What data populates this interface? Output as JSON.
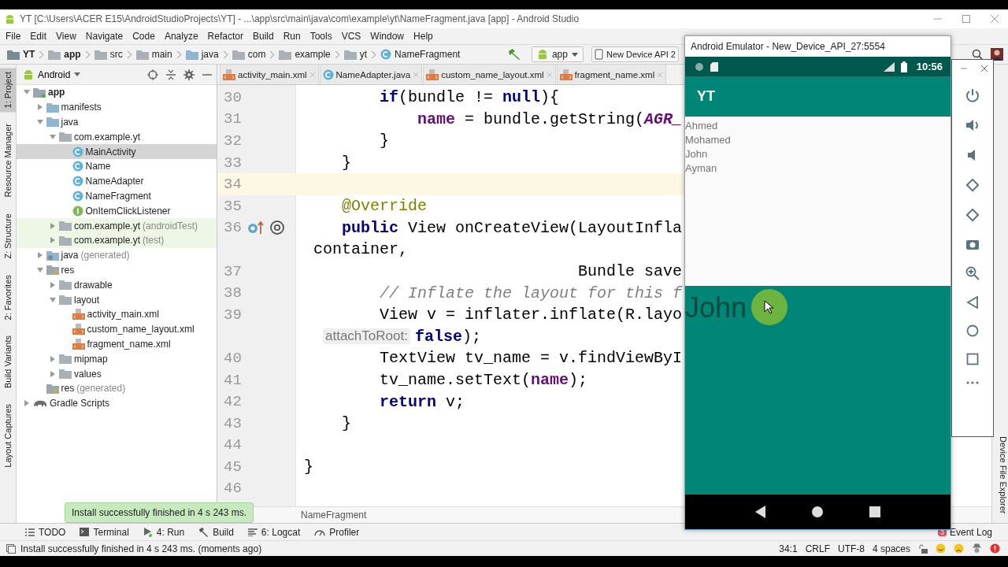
{
  "window": {
    "title": "YT [C:\\Users\\ACER E15\\AndroidStudioProjects\\YT] - ...\\app\\src\\main\\java\\com\\example\\yt\\NameFragment.java [app] - Android Studio"
  },
  "menu": [
    "File",
    "Edit",
    "View",
    "Navigate",
    "Code",
    "Analyze",
    "Refactor",
    "Build",
    "Run",
    "Tools",
    "VCS",
    "Window",
    "Help"
  ],
  "navigation_bar": {
    "breadcrumbs": [
      {
        "label": "YT",
        "kind": "project"
      },
      {
        "label": "app",
        "kind": "module"
      },
      {
        "label": "src",
        "kind": "folder"
      },
      {
        "label": "main",
        "kind": "folder"
      },
      {
        "label": "java",
        "kind": "source"
      },
      {
        "label": "com",
        "kind": "folder"
      },
      {
        "label": "example",
        "kind": "folder"
      },
      {
        "label": "yt",
        "kind": "folder"
      },
      {
        "label": "NameFragment",
        "kind": "class"
      }
    ],
    "run_config": "app",
    "device": "New Device API 2"
  },
  "left_tool_strip": [
    {
      "label": "1: Project",
      "selected": true
    },
    {
      "label": "Resource Manager",
      "selected": false
    },
    {
      "label": "Z: Structure",
      "selected": false
    },
    {
      "label": "2: Favorites",
      "selected": false
    },
    {
      "label": "Build Variants",
      "selected": false
    },
    {
      "label": "Layout Captures",
      "selected": false
    }
  ],
  "project_panel": {
    "view": "Android",
    "tree": [
      {
        "label": "app",
        "kind": "module",
        "expanded": true,
        "selected": false,
        "children": [
          {
            "label": "manifests",
            "kind": "folder",
            "expanded": false,
            "selected": false
          },
          {
            "label": "java",
            "kind": "folder",
            "expanded": true,
            "selected": false,
            "children": [
              {
                "label": "com.example.yt",
                "kind": "package",
                "expanded": true,
                "selected": false,
                "children": [
                  {
                    "label": "MainActivity",
                    "kind": "class",
                    "selected": true
                  },
                  {
                    "label": "Name",
                    "kind": "class",
                    "selected": false
                  },
                  {
                    "label": "NameAdapter",
                    "kind": "class",
                    "selected": false
                  },
                  {
                    "label": "NameFragment",
                    "kind": "class",
                    "selected": false
                  },
                  {
                    "label": "OnItemClickListener",
                    "kind": "interface",
                    "selected": false
                  }
                ]
              },
              {
                "label": "com.example.yt",
                "suffix": "(androidTest)",
                "kind": "test-package",
                "expanded": false,
                "selected": false
              },
              {
                "label": "com.example.yt",
                "suffix": "(test)",
                "kind": "test-package",
                "expanded": false,
                "selected": false
              }
            ]
          },
          {
            "label": "java",
            "suffix": "(generated)",
            "kind": "generated",
            "expanded": false,
            "selected": false
          },
          {
            "label": "res",
            "kind": "res",
            "expanded": true,
            "selected": false,
            "children": [
              {
                "label": "drawable",
                "kind": "package",
                "expanded": false,
                "selected": false
              },
              {
                "label": "layout",
                "kind": "package",
                "expanded": true,
                "selected": false,
                "children": [
                  {
                    "label": "activity_main.xml",
                    "kind": "xml",
                    "selected": false
                  },
                  {
                    "label": "custom_name_layout.xml",
                    "kind": "xml",
                    "selected": false
                  },
                  {
                    "label": "fragment_name.xml",
                    "kind": "xml",
                    "selected": false
                  }
                ]
              },
              {
                "label": "mipmap",
                "kind": "package",
                "expanded": false,
                "selected": false
              },
              {
                "label": "values",
                "kind": "package",
                "expanded": false,
                "selected": false
              }
            ]
          },
          {
            "label": "res",
            "suffix": "(generated)",
            "kind": "res"
          }
        ]
      },
      {
        "label": "Gradle Scripts",
        "kind": "gradle",
        "expanded": false,
        "selected": false
      }
    ]
  },
  "editor": {
    "tabs": [
      {
        "label": "activity_main.xml",
        "kind": "xml",
        "selected": false
      },
      {
        "label": "NameAdapter.java",
        "kind": "class",
        "selected": false
      },
      {
        "label": "custom_name_layout.xml",
        "kind": "xml",
        "selected": false
      },
      {
        "label": "fragment_name.xml",
        "kind": "xml",
        "selected": false
      }
    ],
    "lines": [
      {
        "number": "30",
        "current": false,
        "tokens": [
          {
            "kind": "keyword",
            "text": "        if"
          },
          {
            "kind": "plain",
            "text": "(bundle != "
          },
          {
            "kind": "keyword",
            "text": "null"
          },
          {
            "kind": "plain",
            "text": "){"
          }
        ]
      },
      {
        "number": "31",
        "current": false,
        "tokens": [
          {
            "kind": "field",
            "text": "            name"
          },
          {
            "kind": "plain",
            "text": " = bundle.getString("
          },
          {
            "kind": "constant",
            "text": "AGR_"
          }
        ]
      },
      {
        "number": "32",
        "current": false,
        "tokens": [
          {
            "kind": "plain",
            "text": "        }"
          }
        ]
      },
      {
        "number": "33",
        "current": false,
        "tokens": [
          {
            "kind": "plain",
            "text": "    }"
          }
        ]
      },
      {
        "number": "34",
        "current": true
      },
      {
        "number": "35",
        "current": false,
        "tokens": [
          {
            "kind": "annotation",
            "text": "    @Override"
          }
        ]
      },
      {
        "number": "36",
        "current": false,
        "override_marker": true,
        "tokens": [
          {
            "kind": "keyword",
            "text": "    public"
          },
          {
            "kind": "plain",
            "text": " View onCreateView(LayoutInfla"
          }
        ]
      },
      {
        "current": false,
        "tokens": [
          {
            "kind": "plain",
            "text": " container,"
          }
        ]
      },
      {
        "number": "37",
        "current": false,
        "tokens": [
          {
            "kind": "plain",
            "text": "                             Bundle save"
          }
        ]
      },
      {
        "number": "38",
        "current": false,
        "tokens": [
          {
            "kind": "comment",
            "text": "        // Inflate the layout for this f"
          }
        ]
      },
      {
        "number": "39",
        "current": false,
        "tokens": [
          {
            "kind": "plain",
            "text": "        View v = inflater.inflate(R.layo"
          }
        ]
      },
      {
        "current": false,
        "tokens": [
          {
            "kind": "hint",
            "text": "attachToRoot:"
          },
          {
            "kind": "keyword",
            "text": "false"
          },
          {
            "kind": "plain",
            "text": ");"
          }
        ]
      },
      {
        "number": "40",
        "current": false,
        "tokens": [
          {
            "kind": "plain",
            "text": "        TextView tv_name = v.findViewByI"
          }
        ]
      },
      {
        "number": "41",
        "current": false,
        "tokens": [
          {
            "kind": "plain",
            "text": "        tv_name.setText("
          },
          {
            "kind": "field",
            "text": "name"
          },
          {
            "kind": "plain",
            "text": ");"
          }
        ]
      },
      {
        "number": "42",
        "current": false,
        "tokens": [
          {
            "kind": "keyword",
            "text": "        return"
          },
          {
            "kind": "plain",
            "text": " v;"
          }
        ]
      },
      {
        "number": "43",
        "current": false,
        "tokens": [
          {
            "kind": "plain",
            "text": "    }"
          }
        ]
      },
      {
        "number": "44",
        "current": false
      },
      {
        "number": "45",
        "current": false,
        "tokens": [
          {
            "kind": "plain",
            "text": "}"
          }
        ]
      },
      {
        "number": "46",
        "current": false
      }
    ],
    "breadcrumb": "NameFragment"
  },
  "toast": "Install successfully finished in 4 s 243 ms.",
  "tool_windows": [
    {
      "label": "TODO",
      "kind": "list"
    },
    {
      "label": "Terminal",
      "kind": "terminal"
    },
    {
      "label": "4: Run",
      "kind": "run"
    },
    {
      "label": "Build",
      "kind": "build"
    },
    {
      "label": "6: Logcat",
      "kind": "logcat"
    },
    {
      "label": "Profiler",
      "kind": "profiler"
    }
  ],
  "event_log": {
    "label": "Event Log",
    "count": "3"
  },
  "status_bar": {
    "message": "Install successfully finished in 4 s 243 ms. (moments ago)",
    "position": "34:1",
    "line_separator": "CRLF",
    "encoding": "UTF-8",
    "indent": "4 spaces"
  },
  "right_tool_strip": [
    "Device File Explorer"
  ],
  "emulator": {
    "title": "Android Emulator - New_Device_API_27:5554",
    "clock": "10:56",
    "app_title": "YT",
    "names": [
      "Ahmed",
      "Mohamed",
      "John",
      "Ayman"
    ],
    "detail_name": "John"
  }
}
